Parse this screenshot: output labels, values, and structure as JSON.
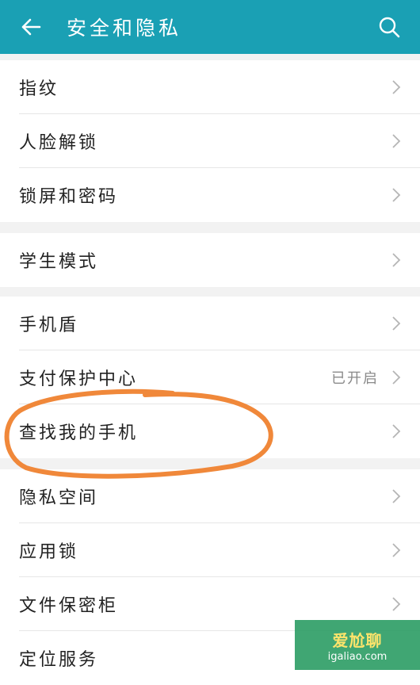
{
  "header": {
    "title": "安全和隐私",
    "back_icon": "arrow-left-icon",
    "search_icon": "search-icon",
    "color": "#1aa0b4"
  },
  "groups": [
    {
      "items": [
        {
          "label": "指纹"
        },
        {
          "label": "人脸解锁"
        },
        {
          "label": "锁屏和密码"
        }
      ]
    },
    {
      "items": [
        {
          "label": "学生模式"
        }
      ]
    },
    {
      "items": [
        {
          "label": "手机盾"
        },
        {
          "label": "支付保护中心",
          "status": "已开启"
        },
        {
          "label": "查找我的手机"
        }
      ]
    },
    {
      "items": [
        {
          "label": "隐私空间"
        },
        {
          "label": "应用锁"
        },
        {
          "label": "文件保密柜"
        },
        {
          "label": "定位服务"
        }
      ]
    }
  ],
  "annotation": {
    "color": "#f0883a"
  },
  "watermark": {
    "line1": "爱尬聊",
    "line2": "igaliao.com"
  }
}
